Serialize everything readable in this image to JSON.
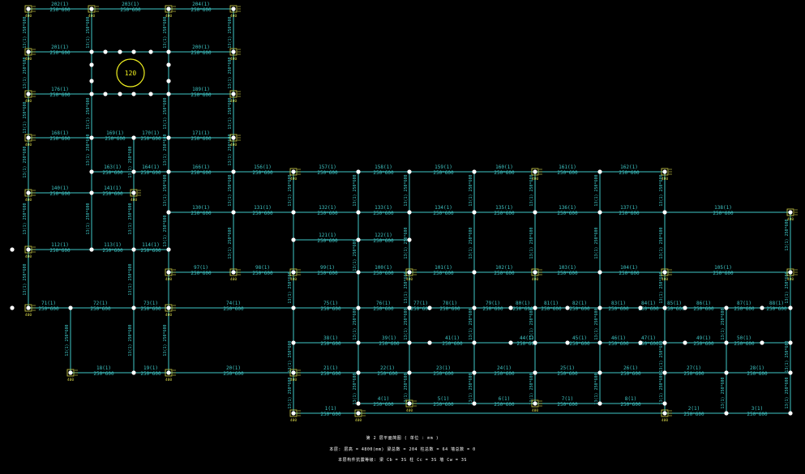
{
  "colors": {
    "background": "#000000",
    "beam": "#3fc8c8",
    "beam_label": "#3fc8c8",
    "column": "#ffffff",
    "column_tag": "#d8d84a",
    "circle": "#f0f020"
  },
  "circle_label": "120",
  "beam_section": "250*600",
  "beam_labels": [
    "202(1)",
    "203(1)",
    "204(1)",
    "201(1)",
    "200(1)",
    "176(1)",
    "189(1)",
    "168(1)",
    "169(1)",
    "170(1)",
    "171(1)",
    "163(1)",
    "164(1)",
    "166(1)",
    "156(1)",
    "157(1)",
    "158(1)",
    "159(1)",
    "160(1)",
    "161(1)",
    "162(1)",
    "140(1)",
    "141(1)",
    "130(1)",
    "131(1)",
    "132(1)",
    "133(1)",
    "134(1)",
    "135(1)",
    "136(1)",
    "137(1)",
    "138(1)",
    "121(1)",
    "122(1)",
    "112(1)",
    "113(1)",
    "114(1)",
    "97(1)",
    "98(1)",
    "99(1)",
    "100(1)",
    "101(1)",
    "102(1)",
    "103(1)",
    "104(1)",
    "105(1)",
    "71(1)",
    "72(1)",
    "73(1)",
    "74(1)",
    "75(1)",
    "76(1)",
    "77(1)",
    "78(1)",
    "79(1)",
    "80(1)",
    "81(1)",
    "82(1)",
    "83(1)",
    "84(1)",
    "85(1)",
    "86(1)",
    "87(1)",
    "88(1)",
    "38(1)",
    "39(1)",
    "41(1)",
    "44(1)",
    "45(1)",
    "46(1)",
    "47(1)",
    "49(1)",
    "50(1)",
    "18(1)",
    "19(1)",
    "20(1)",
    "21(1)",
    "22(1)",
    "23(1)",
    "24(1)",
    "25(1)",
    "26(1)",
    "27(1)",
    "28(1)",
    "1(1)",
    "4(1)",
    "5(1)",
    "6(1)",
    "7(1)",
    "8(1)",
    "2(1)",
    "3(1)"
  ],
  "vertical_beam_label": "13(1) 250*600",
  "column_tag": "400",
  "caption": {
    "line1": "第 2 层平面简图 ( 单位 : mm )",
    "line2": "本层: 层高 = 4800(mm)  梁总数 = 204  柱总数 = 64  墙总数 = 0",
    "line3": "本层构件抗震等级:  梁 Cb = 3S    柱 Cc = 3S    墙 Cw = 3S"
  }
}
